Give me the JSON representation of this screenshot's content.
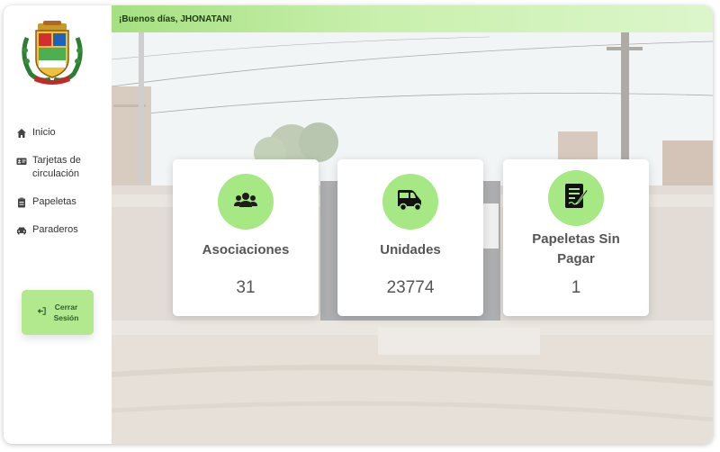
{
  "greeting": "¡Buenos días, JHONATAN!",
  "sidebar": {
    "items": [
      {
        "label": "Inicio",
        "icon": "home-icon"
      },
      {
        "label": "Tarjetas de circulación",
        "icon": "id-card-icon"
      },
      {
        "label": "Papeletas",
        "icon": "clipboard-icon"
      },
      {
        "label": "Paraderos",
        "icon": "car-icon"
      }
    ],
    "logout_label": "Cerrar\nSesión"
  },
  "cards": [
    {
      "title": "Asociaciones",
      "value": "31",
      "icon": "users-icon"
    },
    {
      "title": "Unidades",
      "value": "23774",
      "icon": "mototaxi-icon"
    },
    {
      "title": "Papeletas Sin Pagar",
      "value": "1",
      "icon": "document-sign-icon"
    }
  ],
  "colors": {
    "accent": "#a6e883",
    "topbar": "#b8e898",
    "logout": "#b2e88e"
  }
}
